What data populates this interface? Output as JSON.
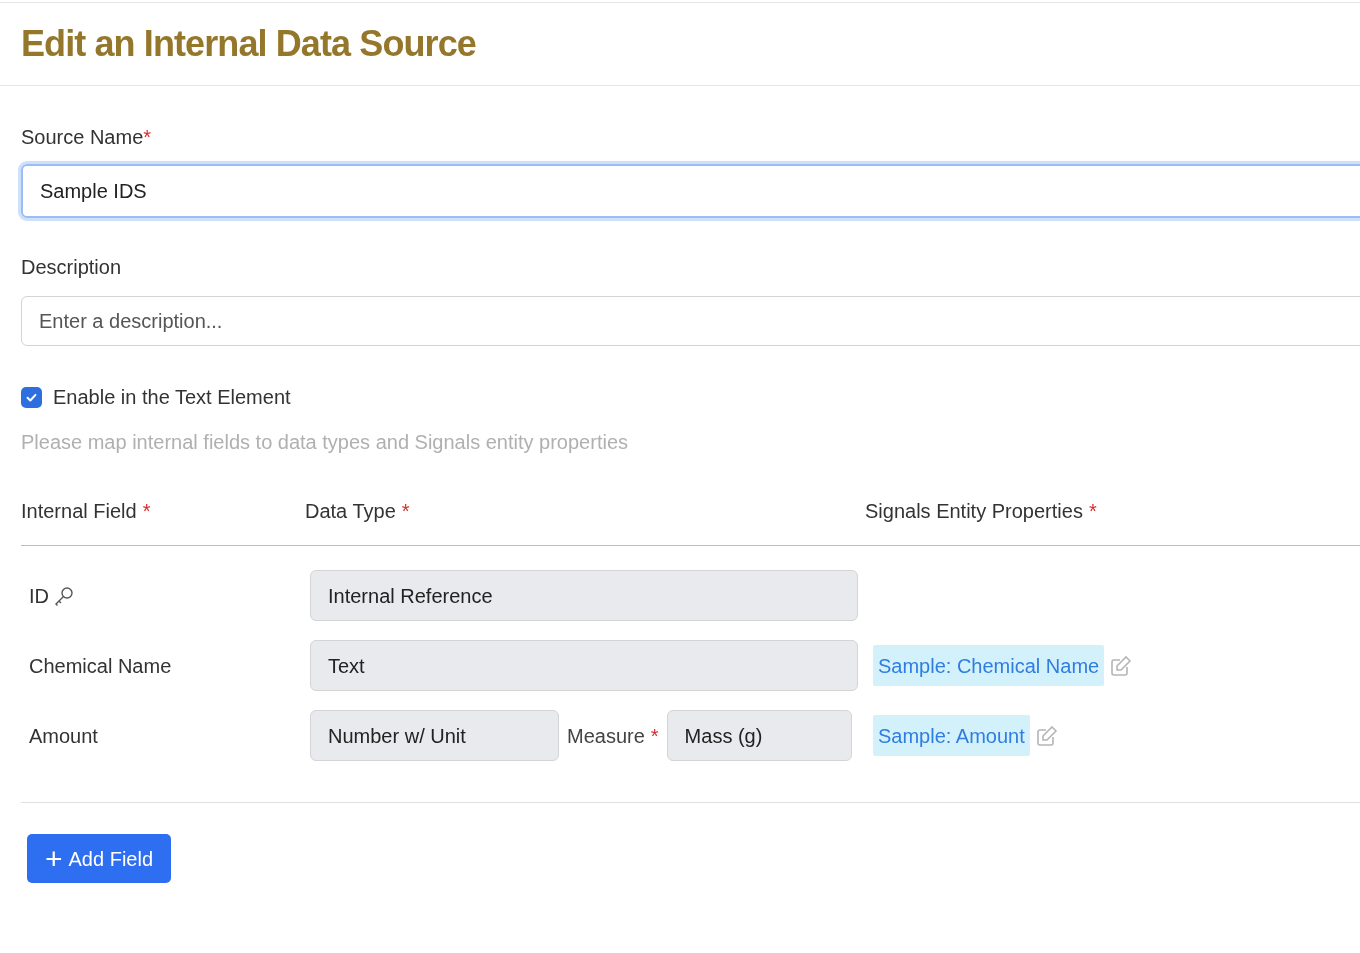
{
  "title": "Edit an Internal Data Source",
  "source_name": {
    "label": "Source Name",
    "required_mark": "*",
    "value": "Sample IDS",
    "focused": true
  },
  "description": {
    "label": "Description",
    "placeholder": "Enter a description..."
  },
  "enable": {
    "label": "Enable in the Text Element",
    "checked": true
  },
  "hint": "Please map internal fields to data types and Signals entity properties",
  "columns": [
    {
      "label": "Internal Field",
      "required_mark": "*"
    },
    {
      "label": "Data Type",
      "required_mark": "*"
    },
    {
      "label": "Signals Entity Properties",
      "required_mark": "*"
    }
  ],
  "rows": [
    {
      "field": "ID",
      "key": true,
      "data_type": "Internal Reference"
    },
    {
      "field": "Chemical Name",
      "key": false,
      "data_type": "Text",
      "property": "Sample: Chemical Name"
    },
    {
      "field": "Amount",
      "key": false,
      "data_type": "Number w/ Unit",
      "measure": {
        "label": "Measure",
        "required_mark": "*",
        "value": "Mass (g)"
      },
      "property": "Sample: Amount"
    }
  ],
  "add_button": {
    "icon": "+",
    "label": "Add Field"
  }
}
